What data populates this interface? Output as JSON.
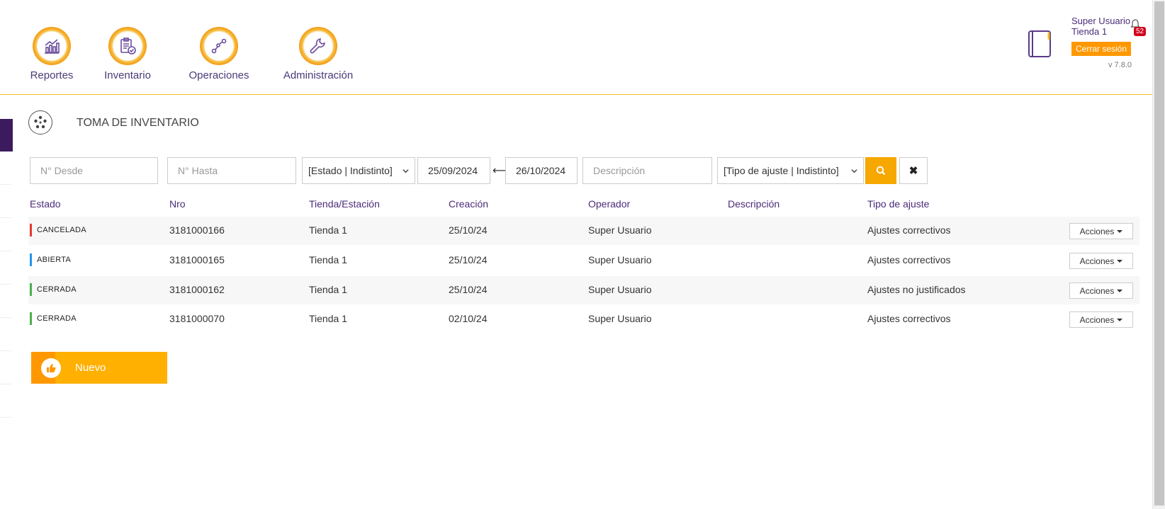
{
  "nav": {
    "items": [
      {
        "label": "Reportes",
        "icon": "chart-icon"
      },
      {
        "label": "Inventario",
        "icon": "clipboard-check-icon"
      },
      {
        "label": "Operaciones",
        "icon": "route-icon"
      },
      {
        "label": "Administración",
        "icon": "wrench-icon"
      }
    ]
  },
  "user": {
    "name": "Super Usuario",
    "store": "Tienda 1",
    "notifications": "52",
    "logout_label": "Cerrar sesión",
    "version": "v 7.8.0"
  },
  "page": {
    "title": "TOMA DE INVENTARIO"
  },
  "filters": {
    "desde_placeholder": "N° Desde",
    "hasta_placeholder": "N° Hasta",
    "estado_selected": "[Estado | Indistinto]",
    "date_from": "25/09/2024",
    "date_to": "26/10/2024",
    "descripcion_placeholder": "Descripción",
    "tipo_selected": "[Tipo de ajuste | Indistinto]"
  },
  "table": {
    "headers": [
      "Estado",
      "Nro",
      "Tienda/Estación",
      "Creación",
      "Operador",
      "Descripción",
      "Tipo de ajuste"
    ],
    "action_label": "Acciones",
    "rows": [
      {
        "estado": "CANCELADA",
        "color": "#e53935",
        "nro": "3181000166",
        "tienda": "Tienda 1",
        "creacion": "25/10/24",
        "operador": "Super Usuario",
        "descripcion": "",
        "tipo": "Ajustes correctivos"
      },
      {
        "estado": "ABIERTA",
        "color": "#2196f3",
        "nro": "3181000165",
        "tienda": "Tienda 1",
        "creacion": "25/10/24",
        "operador": "Super Usuario",
        "descripcion": "",
        "tipo": "Ajustes correctivos"
      },
      {
        "estado": "CERRADA",
        "color": "#4caf50",
        "nro": "3181000162",
        "tienda": "Tienda 1",
        "creacion": "25/10/24",
        "operador": "Super Usuario",
        "descripcion": "",
        "tipo": "Ajustes no justificados"
      },
      {
        "estado": "CERRADA",
        "color": "#4caf50",
        "nro": "3181000070",
        "tienda": "Tienda 1",
        "creacion": "02/10/24",
        "operador": "Super Usuario",
        "descripcion": "",
        "tipo": "Ajustes correctivos"
      }
    ]
  },
  "actions": {
    "nuevo_label": "Nuevo"
  },
  "colors": {
    "brand_purple": "#4b2c7a",
    "accent_orange": "#ff9800",
    "accent_yellow": "#f6a800"
  }
}
